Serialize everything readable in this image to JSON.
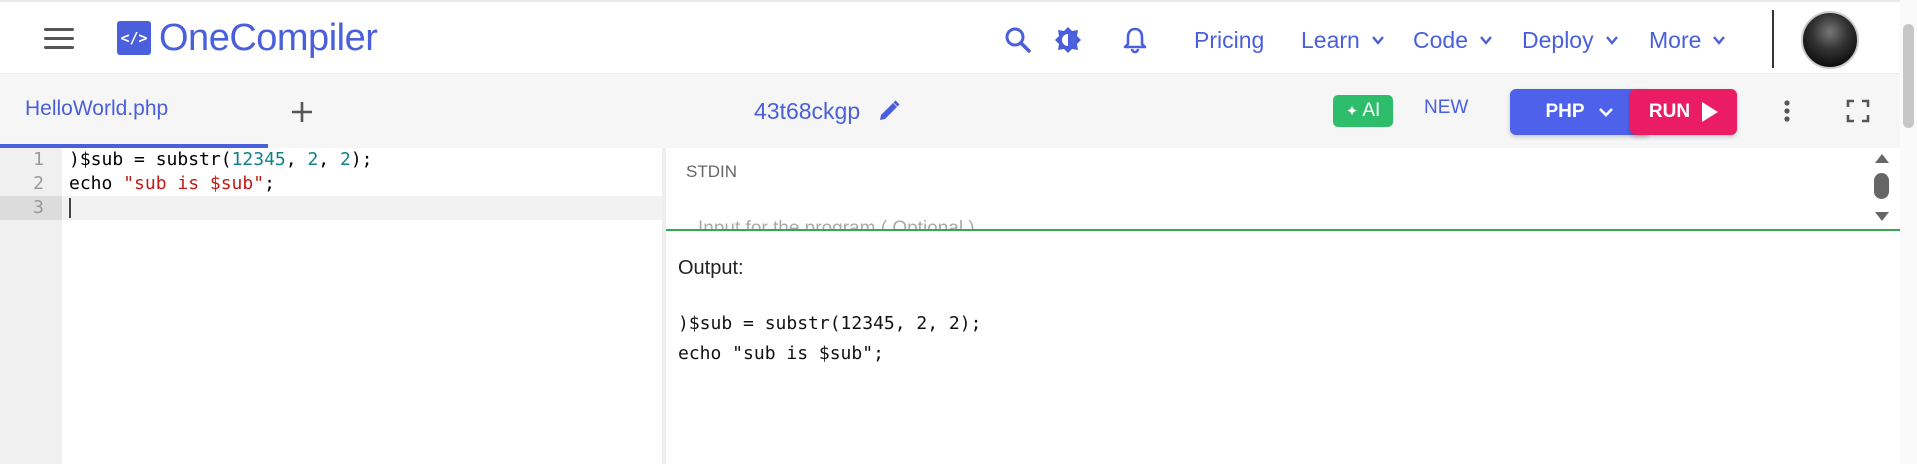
{
  "brand": {
    "logo_mark": "</>",
    "name": "OneCompiler"
  },
  "nav": {
    "icons": [
      "search-icon",
      "theme-icon",
      "bell-icon"
    ],
    "links": [
      {
        "label": "Pricing",
        "dropdown": false
      },
      {
        "label": "Learn",
        "dropdown": true
      },
      {
        "label": "Code",
        "dropdown": true
      },
      {
        "label": "Deploy",
        "dropdown": true
      },
      {
        "label": "More",
        "dropdown": true
      }
    ]
  },
  "toolbar": {
    "file_tab": "HelloWorld.php",
    "slug": "43t68ckgp",
    "ai_label": "AI",
    "new_label": "NEW",
    "language_label": "PHP",
    "run_label": "RUN"
  },
  "editor": {
    "lines": [
      {
        "num": "1"
      },
      {
        "num": "2"
      },
      {
        "num": "3"
      }
    ],
    "code": {
      "l1_a": ")$sub = substr(",
      "l1_n1": "12345",
      "l1_b": ", ",
      "l1_n2": "2",
      "l1_c": ", ",
      "l1_n3": "2",
      "l1_d": ");",
      "l2_a": "echo ",
      "l2_str": "\"sub is $sub\"",
      "l2_b": ";"
    }
  },
  "stdin": {
    "label": "STDIN",
    "placeholder": "Input for the program ( Optional )"
  },
  "output": {
    "title": "Output:",
    "lines": [
      ")$sub = substr(12345, 2, 2);",
      "echo \"sub is $sub\";"
    ]
  },
  "colors": {
    "brand": "#4a5fdb",
    "ai": "#2ebd6b",
    "language": "#4e61ea",
    "run": "#ea1d64",
    "divider": "#34a853"
  }
}
